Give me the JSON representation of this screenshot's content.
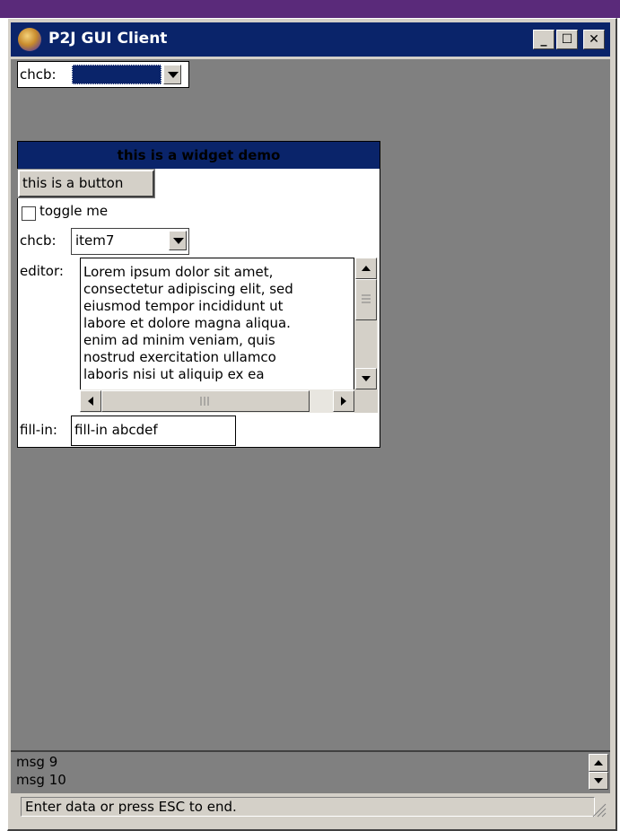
{
  "window": {
    "title": "P2J GUI Client"
  },
  "titlebar_buttons": {
    "minimize": "_",
    "maximize": "☐",
    "close": "✕"
  },
  "top_combo": {
    "label": "chcb:",
    "value": ""
  },
  "frame": {
    "title": "this is a widget demo",
    "button_label": "this is a button",
    "toggle_label": "toggle me",
    "toggle_checked": false,
    "chcb_label": "chcb:",
    "chcb_value": "item7",
    "editor_label": "editor:",
    "editor_text": "Lorem ipsum dolor sit amet,\nconsectetur adipiscing elit, sed\neiusmod tempor incididunt ut\nlabore et dolore magna aliqua.\nenim ad minim veniam, quis\nnostrud exercitation ullamco\nlaboris nisi ut aliquip ex ea",
    "fillin_label": "fill-in:",
    "fillin_value": "fill-in abcdef"
  },
  "messages": [
    "msg 9",
    "msg 10"
  ],
  "status": {
    "text": "Enter data or press ESC to end."
  },
  "colors": {
    "titlebar": "#0a246a",
    "client": "#808080",
    "chrome": "#d4d0c8"
  },
  "icons": [
    "app-icon",
    "chevron-down-icon",
    "arrow-up-icon",
    "arrow-down-icon",
    "arrow-left-icon",
    "arrow-right-icon",
    "resize-grip-icon"
  ]
}
